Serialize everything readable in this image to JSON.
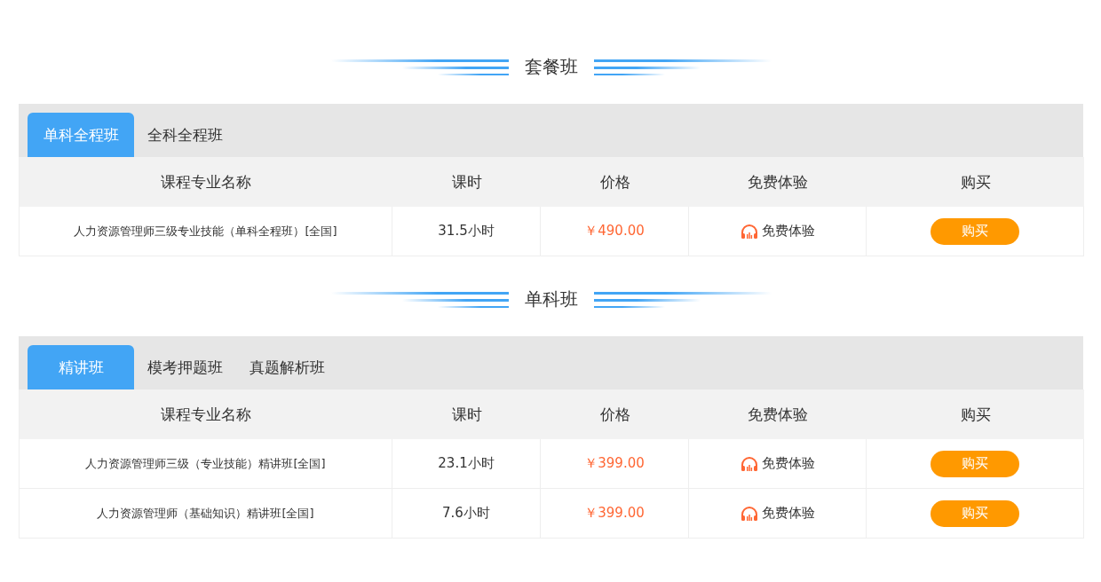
{
  "sections": [
    {
      "title": "套餐班",
      "tabs": [
        {
          "label": "单科全程班",
          "selected": true
        },
        {
          "label": "全科全程班",
          "selected": false
        }
      ],
      "columns": [
        "课程专业名称",
        "课时",
        "价格",
        "免费体验",
        "购买"
      ],
      "rows": [
        {
          "name": "人力资源管理师三级专业技能（单科全程班）[全国]",
          "hours": "31.5小时",
          "price": "￥490.00",
          "trial": "免费体验",
          "buy": "购买"
        }
      ]
    },
    {
      "title": "单科班",
      "tabs": [
        {
          "label": "精讲班",
          "selected": true
        },
        {
          "label": "模考押题班",
          "selected": false
        },
        {
          "label": "真题解析班",
          "selected": false
        }
      ],
      "columns": [
        "课程专业名称",
        "课时",
        "价格",
        "免费体验",
        "购买"
      ],
      "rows": [
        {
          "name": "人力资源管理师三级（专业技能）精讲班[全国]",
          "hours": "23.1小时",
          "price": "￥399.00",
          "trial": "免费体验",
          "buy": "购买"
        },
        {
          "name": "人力资源管理师（基础知识）精讲班[全国]",
          "hours": "7.6小时",
          "price": "￥399.00",
          "trial": "免费体验",
          "buy": "购买"
        }
      ]
    }
  ]
}
